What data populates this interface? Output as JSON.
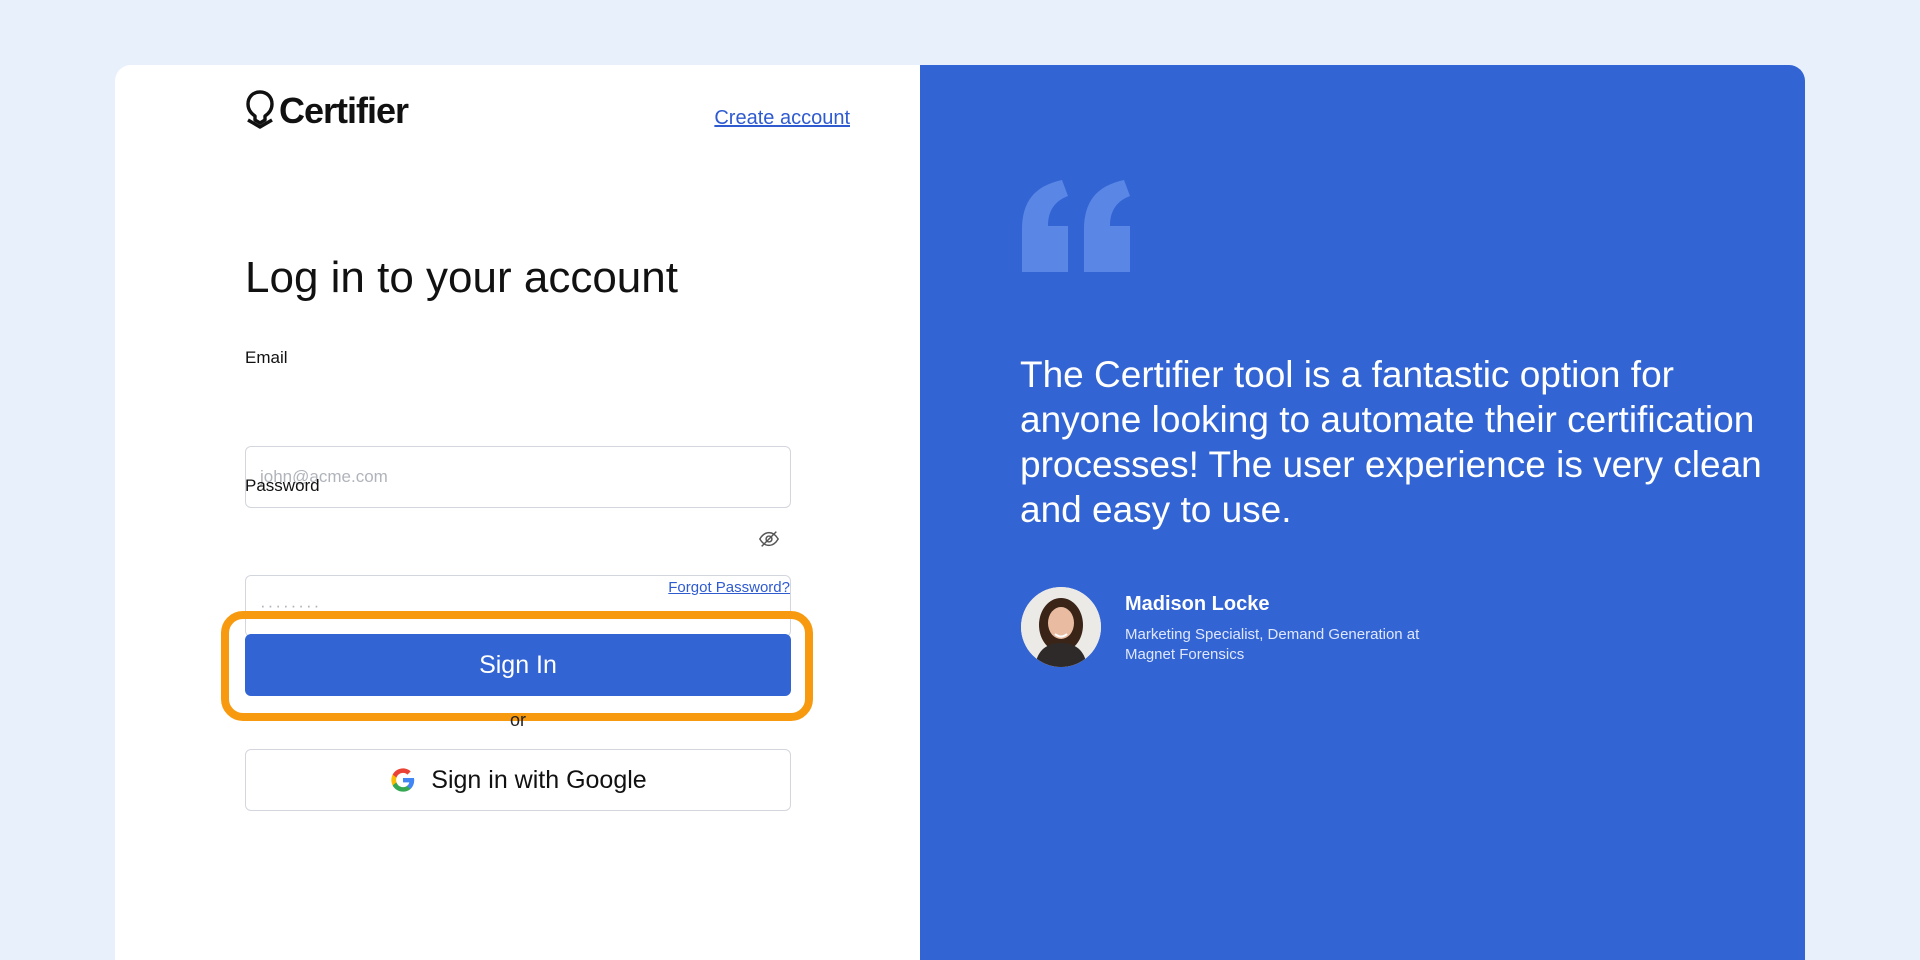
{
  "brand": {
    "name": "Certifier"
  },
  "header": {
    "create_account_link": "Create account"
  },
  "login": {
    "title": "Log in to your account",
    "email_label": "Email",
    "email_placeholder": "john@acme.com",
    "password_label": "Password",
    "password_placeholder": "········",
    "forgot_password": "Forgot Password?",
    "signin_button": "Sign In",
    "or_text": "or",
    "google_button": "Sign in with Google"
  },
  "testimonial": {
    "quote": "The Certifier tool is a fantastic option for anyone looking to automate their certification processes! The user experience is very clean and easy to use.",
    "author_name": "Madison Locke",
    "author_role": "Marketing Specialist, Demand Generation at Magnet Forensics"
  },
  "icons": {
    "logo": "certifier-logo-icon",
    "password_toggle": "eye-off-icon",
    "google": "google-icon",
    "quote": "quote-mark-icon"
  },
  "colors": {
    "accent": "#3264d3",
    "highlight": "#f79a0f",
    "page_background": "#e8f0fc",
    "link": "#2f5bd1"
  }
}
